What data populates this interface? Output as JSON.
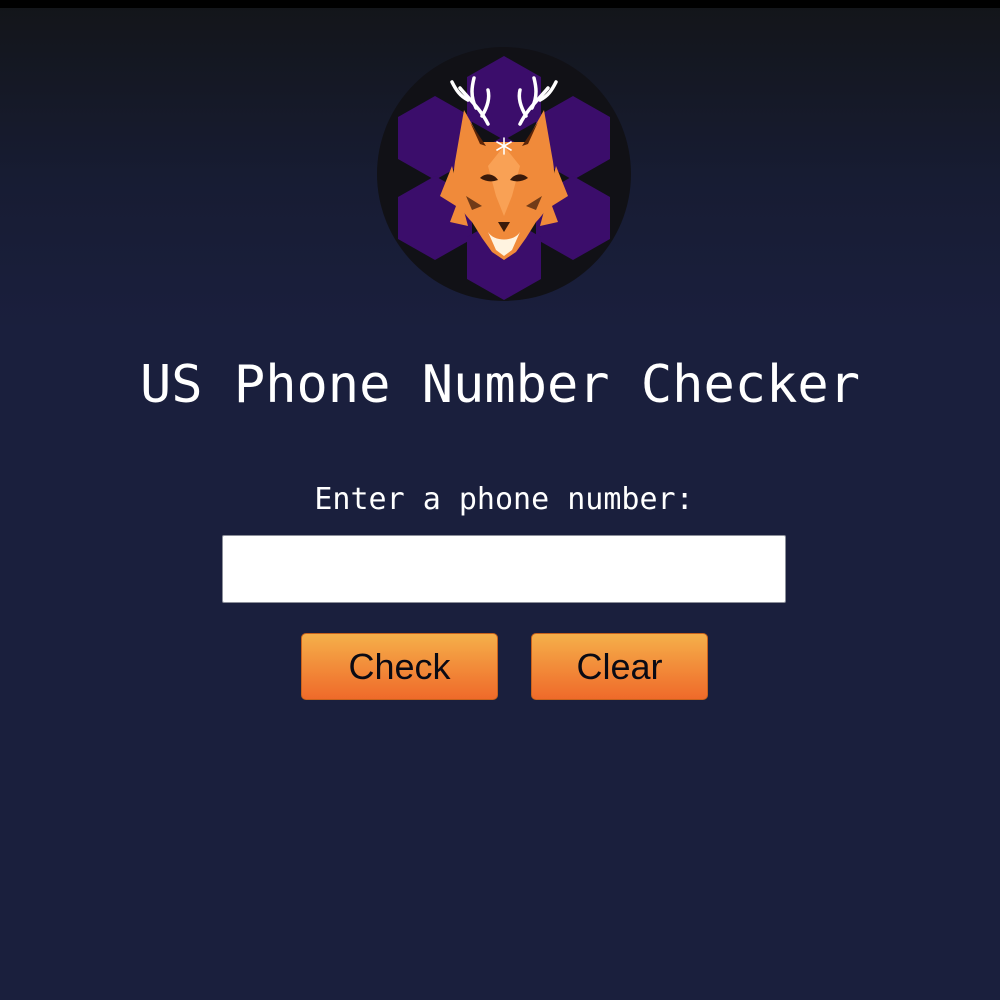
{
  "page": {
    "title": "US Phone Number Checker"
  },
  "form": {
    "label": "Enter a phone number:",
    "input_value": "",
    "input_placeholder": "",
    "check_label": "Check",
    "clear_label": "Clear"
  },
  "logo": {
    "icon": "fox-with-antlers-logo",
    "colors": {
      "background": "#111116",
      "hexagons": "#3b0d6b",
      "fox": "#f08a3a",
      "antlers": "#ffffff"
    }
  },
  "colors": {
    "background": "#1a1f3d",
    "text": "#ffffff",
    "button_top": "#f5b04a",
    "button_bottom": "#ef6a2a"
  }
}
